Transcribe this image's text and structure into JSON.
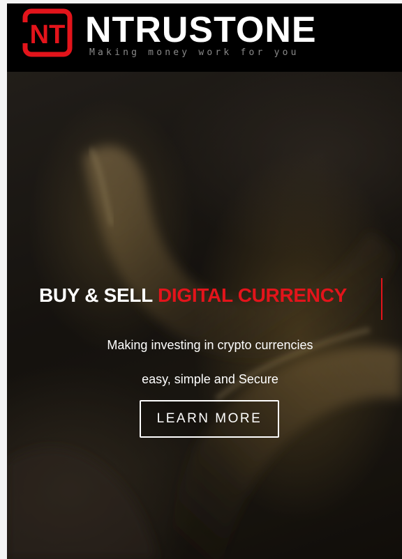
{
  "brand": {
    "logo_letters": "NT",
    "name": "NTRUSTONE",
    "tagline": "Making money work for you"
  },
  "hero": {
    "heading_white": "BUY & SELL ",
    "heading_red": "DIGITAL CURRENCY",
    "line1": "Making investing in crypto currencies",
    "line2": "easy, simple and Secure",
    "cta_label": "LEARN MORE"
  },
  "colors": {
    "accent_red": "#e3141b",
    "header_bg": "#000000",
    "text_white": "#ffffff"
  },
  "icons": {
    "logo": "nt-monogram-icon"
  }
}
